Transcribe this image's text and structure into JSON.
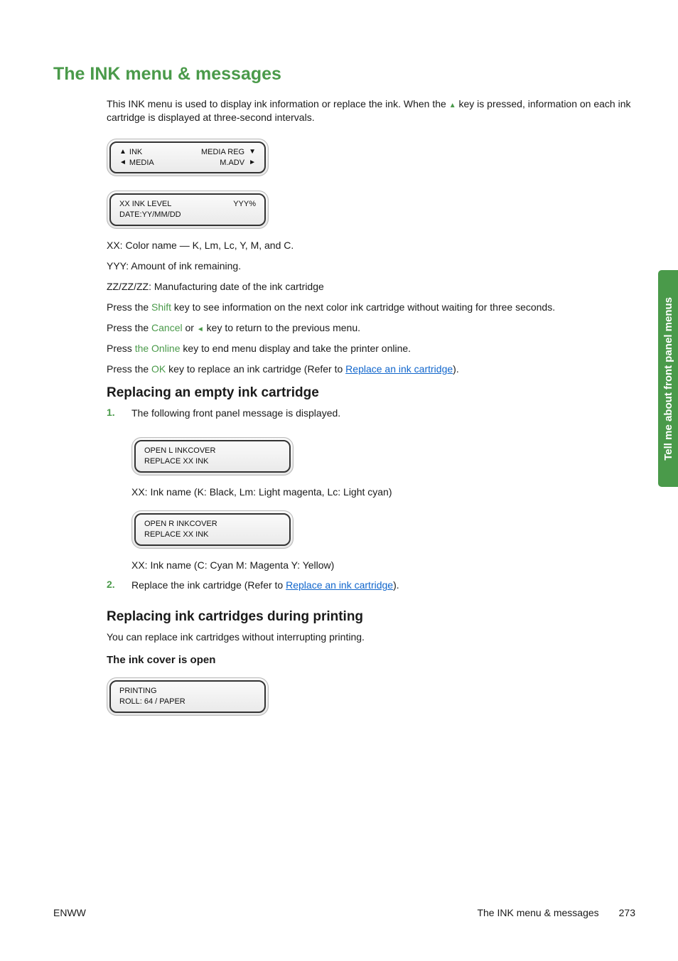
{
  "sidetab": "Tell me about front panel menus",
  "h1": "The INK menu & messages",
  "intro_a": "This INK menu is used to display ink information or replace the ink. When the ",
  "intro_b": " key is pressed, information on each ink cartridge is displayed at three-second intervals.",
  "lcd1": {
    "r1_left_sym": "▲",
    "r1_left": "INK",
    "r1_right": "MEDIA REG",
    "r1_right_sym": "▼",
    "r2_left_sym": "◄",
    "r2_left": "MEDIA",
    "r2_right": "M.ADV",
    "r2_right_sym": "►"
  },
  "lcd2": {
    "r1_left": "XX INK LEVEL",
    "r1_right": "YYY%",
    "r2_left": "DATE:YY/MM/DD"
  },
  "p_xx": "XX: Color name — K, Lm, Lc, Y, M, and C.",
  "p_yyy": "YYY: Amount of ink remaining.",
  "p_zz": "ZZ/ZZ/ZZ: Manufacturing date of the ink cartridge",
  "p_shift_a": "Press the ",
  "k_shift": "Shift",
  "p_shift_b": " key to see information on the next color ink cartridge without waiting for three seconds.",
  "p_cancel_a": "Press the ",
  "k_cancel": "Cancel",
  "p_cancel_mid": " or ",
  "sym_left": "◄",
  "p_cancel_b": " key to return to the previous menu.",
  "p_online_a": "Press ",
  "k_online": "the Online",
  "p_online_b": " key to end menu display and take the printer online.",
  "p_ok_a": "Press the ",
  "k_ok": "OK",
  "p_ok_b": " key to replace an ink cartridge (Refer to ",
  "link_replace": "Replace an ink cartridge",
  "p_ok_c": ").",
  "h2a": "Replacing an empty ink cartridge",
  "step1_num": "1.",
  "step1_text": "The following front panel message is displayed.",
  "lcd3": {
    "l1": "OPEN L INKCOVER",
    "l2": "REPLACE XX INK"
  },
  "step1_note1": "XX: Ink name (K: Black, Lm: Light magenta, Lc: Light cyan)",
  "lcd4": {
    "l1": "OPEN R INKCOVER",
    "l2": "REPLACE XX INK"
  },
  "step1_note2": "XX: Ink name (C: Cyan M: Magenta Y: Yellow)",
  "step2_num": "2.",
  "step2_a": "Replace the ink cartridge (Refer to ",
  "step2_b": ").",
  "h2b": "Replacing ink cartridges during printing",
  "p_during": "You can replace ink cartridges without interrupting printing.",
  "h3": "The ink cover is open",
  "lcd5": {
    "l1": "PRINTING",
    "l2": "ROLL: 64 / PAPER"
  },
  "footer": {
    "left": "ENWW",
    "mid": "The INK menu & messages",
    "page": "273"
  }
}
